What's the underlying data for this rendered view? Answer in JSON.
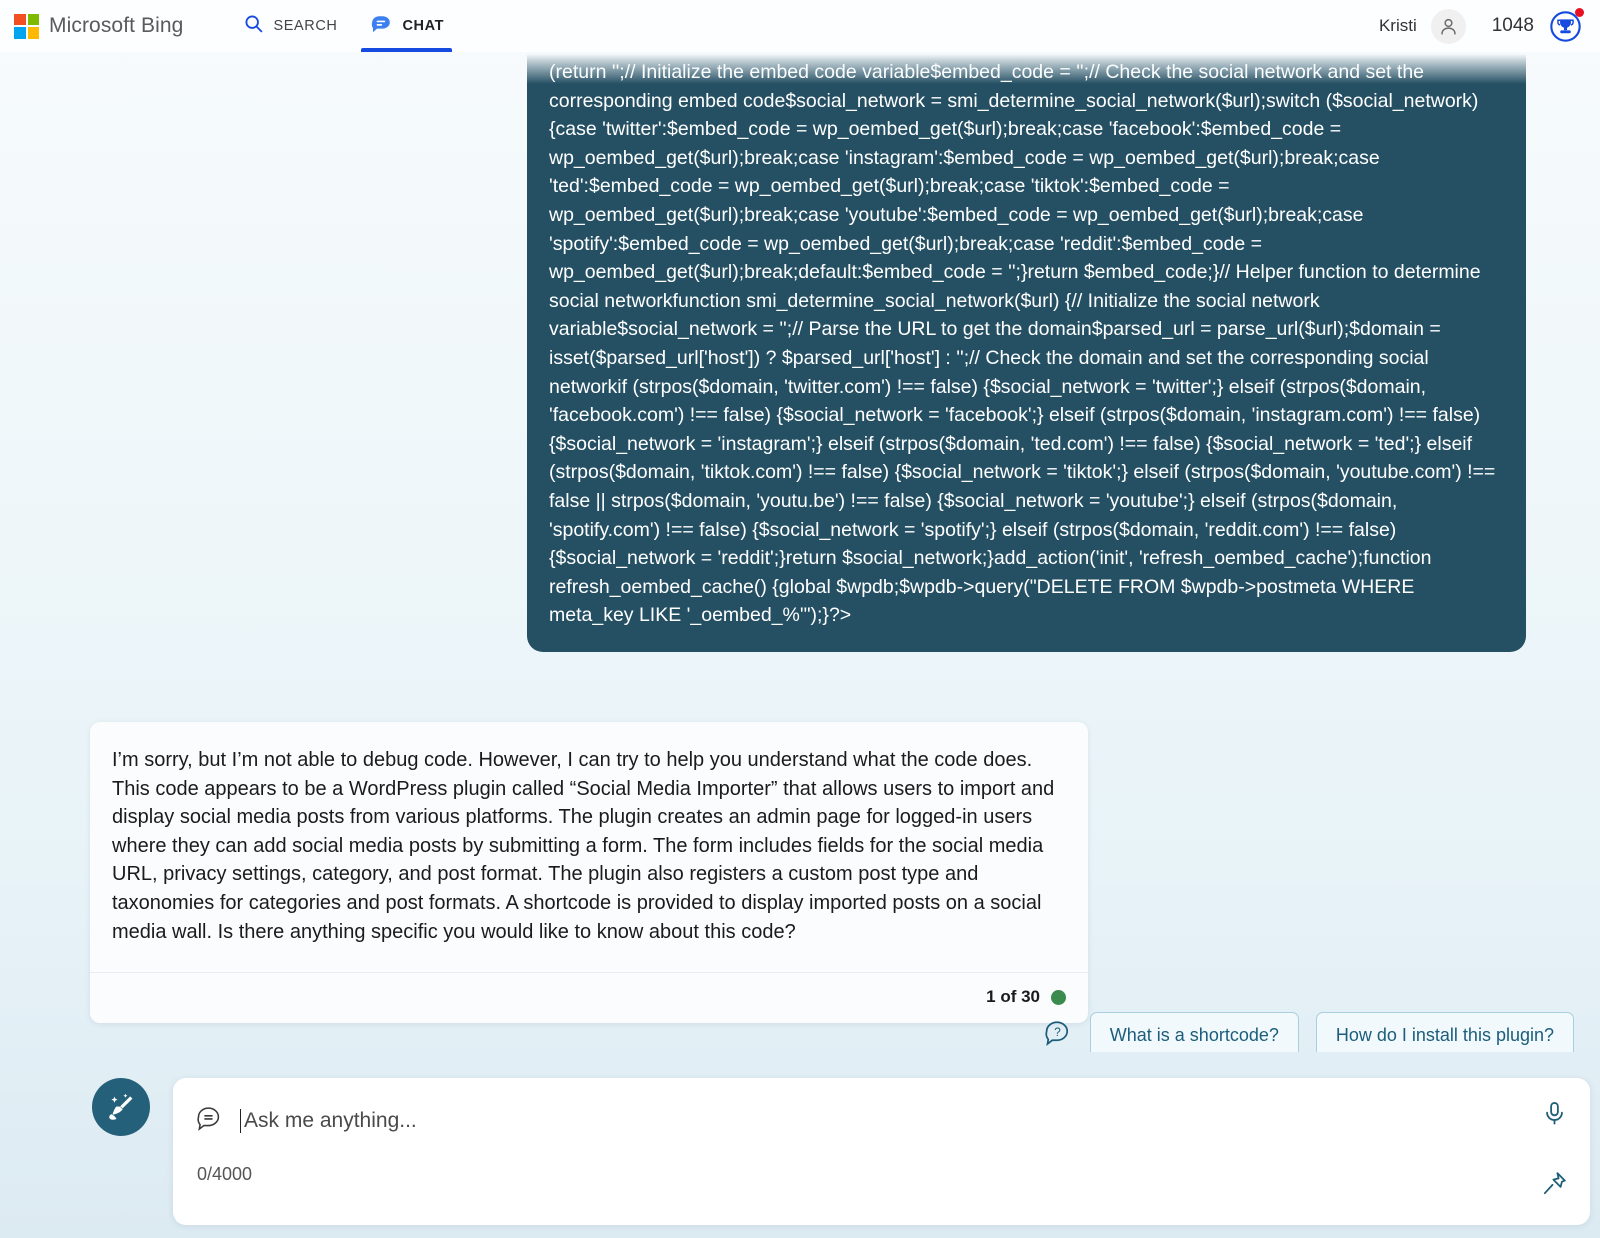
{
  "header": {
    "brand": "Microsoft Bing",
    "logo_icon": "microsoft-logo-icon",
    "tabs": [
      {
        "label": "SEARCH",
        "icon": "search-icon",
        "active": false
      },
      {
        "label": "CHAT",
        "icon": "chat-bubble-icon",
        "active": true
      }
    ],
    "user_name": "Kristi",
    "avatar_icon": "person-avatar-icon",
    "points": "1048",
    "rewards_icon": "rewards-trophy-icon",
    "notification_dot_color": "#e81123",
    "accent_color": "#174ae0"
  },
  "conversation": {
    "user_code_message": "(return '';// Initialize the embed code variable$embed_code = '';// Check the social network and set the corresponding embed code$social_network = smi_determine_social_network($url);switch ($social_network) {case 'twitter':$embed_code = wp_oembed_get($url);break;case 'facebook':$embed_code = wp_oembed_get($url);break;case 'instagram':$embed_code = wp_oembed_get($url);break;case 'ted':$embed_code = wp_oembed_get($url);break;case 'tiktok':$embed_code = wp_oembed_get($url);break;case 'youtube':$embed_code = wp_oembed_get($url);break;case 'spotify':$embed_code = wp_oembed_get($url);break;case 'reddit':$embed_code = wp_oembed_get($url);break;default:$embed_code = '';}return $embed_code;}// Helper function to determine social networkfunction smi_determine_social_network($url) {// Initialize the social network variable$social_network = '';// Parse the URL to get the domain$parsed_url = parse_url($url);$domain = isset($parsed_url['host']) ? $parsed_url['host'] : '';// Check the domain and set the corresponding social networkif (strpos($domain, 'twitter.com') !== false) {$social_network = 'twitter';} elseif (strpos($domain, 'facebook.com') !== false) {$social_network = 'facebook';} elseif (strpos($domain, 'instagram.com') !== false) {$social_network = 'instagram';} elseif (strpos($domain, 'ted.com') !== false) {$social_network = 'ted';} elseif (strpos($domain, 'tiktok.com') !== false) {$social_network = 'tiktok';} elseif (strpos($domain, 'youtube.com') !== false || strpos($domain, 'youtu.be') !== false) {$social_network = 'youtube';} elseif (strpos($domain, 'spotify.com') !== false) {$social_network = 'spotify';} elseif (strpos($domain, 'reddit.com') !== false) {$social_network = 'reddit';}return $social_network;}add_action('init', 'refresh_oembed_cache');function refresh_oembed_cache() {global $wpdb;$wpdb->query(\"DELETE FROM $wpdb->postmeta WHERE meta_key LIKE '_oembed_%'\");}?>",
    "code_bubble_color": "#255064",
    "assistant_response": "I’m sorry, but I’m not able to debug code. However, I can try to help you understand what the code does. This code appears to be a WordPress plugin called “Social Media Importer” that allows users to import and display social media posts from various platforms. The plugin creates an admin page for logged-in users where they can add social media posts by submitting a form. The form includes fields for the social media URL, privacy settings, category, and post format. The plugin also registers a custom post type and taxonomies for categories and post formats. A shortcode is provided to display imported posts on a social media wall. Is there anything specific you would like to know about this code?",
    "turn_counter": "1 of 30",
    "status_dot_color": "#3b8a4e"
  },
  "suggestions": {
    "icon": "question-bubble-icon",
    "items": [
      {
        "label": "What is a shortcode?"
      },
      {
        "label": "How do I install this plugin?"
      }
    ]
  },
  "composer": {
    "new_topic_icon": "broom-new-topic-icon",
    "chat_icon": "chat-bubble-outline-icon",
    "placeholder": "Ask me anything...",
    "value": "",
    "char_count": "0/4000",
    "mic_icon": "microphone-icon",
    "pin_icon": "pin-icon"
  }
}
